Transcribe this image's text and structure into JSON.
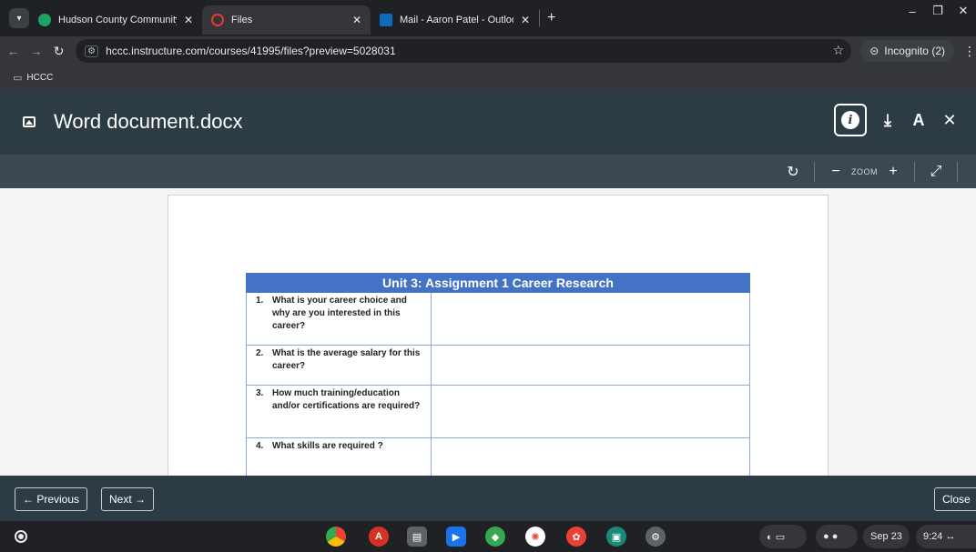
{
  "browser": {
    "tabs": [
      {
        "label": "Hudson County Community Co",
        "active": false,
        "favicon_color": "#1ea362"
      },
      {
        "label": "Files",
        "active": true,
        "favicon_color": "#e63b2e"
      },
      {
        "label": "Mail - Aaron Patel - Outlook",
        "active": false,
        "favicon_color": "#0f6cbd"
      }
    ],
    "new_tab": "+",
    "url": "hccc.instructure.com/courses/41995/files?preview=5028031",
    "incognito_label": "Incognito (2)",
    "bookmark": "HCCC"
  },
  "preview": {
    "title": "Word document.docx",
    "zoom_label": "ZOOM",
    "document": {
      "table_title": "Unit 3: Assignment 1 Career Research",
      "questions": [
        {
          "num": "1.",
          "text": "What is your career choice and why are you interested in this career?"
        },
        {
          "num": "2.",
          "text": "What is the average salary for this career?"
        },
        {
          "num": "3.",
          "text": "How much training/education and/or certifications are required?"
        },
        {
          "num": "4.",
          "text": "What skills are required ?"
        }
      ]
    },
    "previous_label": "← Previous",
    "next_label": "Next →",
    "close_label": "Close"
  },
  "shelf": {
    "date": "Sep 23",
    "time": "9:24",
    "apps": [
      {
        "name": "chrome-icon",
        "color": "#f4b400"
      },
      {
        "name": "acrobat-icon",
        "color": "#d93025"
      },
      {
        "name": "files-icon",
        "color": "#5f6368"
      },
      {
        "name": "screencast-icon",
        "color": "#1a73e8"
      },
      {
        "name": "vpn-icon",
        "color": "#34a853"
      },
      {
        "name": "canvas-icon",
        "color": "#e34c39"
      },
      {
        "name": "chatgpt-icon",
        "color": "#e94235"
      },
      {
        "name": "outlook-icon",
        "color": "#1a8a78"
      },
      {
        "name": "settings-icon",
        "color": "#5f6368"
      }
    ]
  }
}
